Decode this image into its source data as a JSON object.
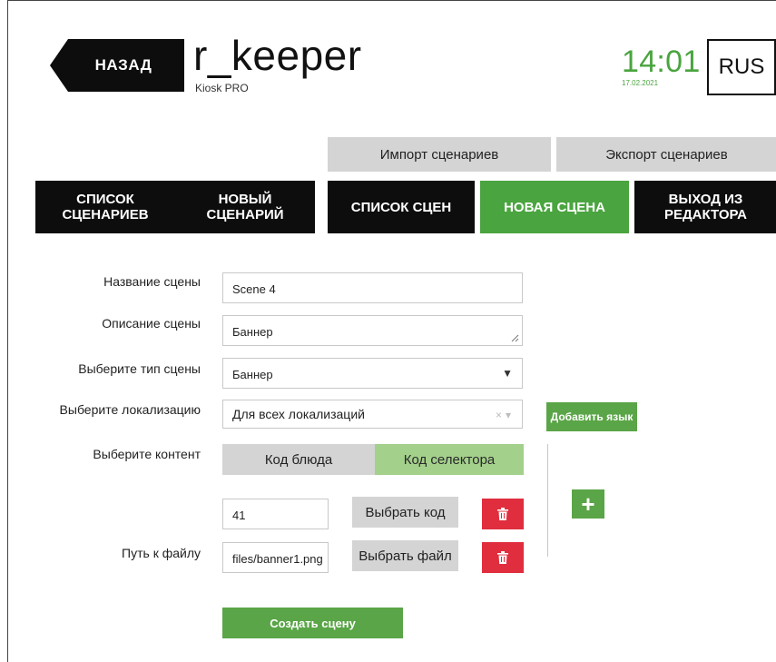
{
  "header": {
    "back_label": "НАЗАД",
    "app_title": "r_keeper",
    "app_subtitle": "Kiosk PRO",
    "time": "14:01",
    "date": "17.02.2021",
    "language": "RUS"
  },
  "actions": {
    "import_label": "Импорт сценариев",
    "export_label": "Экспорт сценариев"
  },
  "tabs": [
    {
      "label": "СПИСОК\nСЦЕНАРИЕВ",
      "active": false
    },
    {
      "label": "НОВЫЙ\nСЦЕНАРИЙ",
      "active": false
    },
    {
      "label": "СПИСОК СЦЕН",
      "active": false
    },
    {
      "label": "НОВАЯ СЦЕНА",
      "active": true
    },
    {
      "label": "ВЫХОД ИЗ\nРЕДАКТОРА",
      "active": false
    }
  ],
  "form": {
    "scene_name": {
      "label": "Название сцены",
      "value": "Scene 4"
    },
    "scene_description": {
      "label": "Описание сцены",
      "value": "Баннер"
    },
    "scene_type": {
      "label": "Выберите тип сцены",
      "value": "Баннер"
    },
    "localization": {
      "label": "Выберите локализацию",
      "value": "Для всех локализаций",
      "clear_glyph": "×",
      "dropdown_glyph": "▾"
    },
    "add_language_label": "Добавить язык",
    "content": {
      "label": "Выберите контент",
      "options": [
        "Код блюда",
        "Код селектора"
      ],
      "selected": "Код селектора"
    },
    "code_value": "41",
    "choose_code_label": "Выбрать код",
    "file_path": {
      "label": "Путь к файлу",
      "value": "files/banner1.png"
    },
    "choose_file_label": "Выбрать файл",
    "plus_label": "+",
    "create_label": "Создать сцену"
  },
  "colors": {
    "accent_green": "#4aa43f",
    "button_green": "#5aa547",
    "segment_selected": "#a3d08b",
    "delete_red": "#e02e3e",
    "neutral_gray": "#d4d4d4",
    "dark": "#0d0d0d"
  },
  "icons": {
    "back": "back-arrow-shape",
    "trash": "trash-icon",
    "plus": "plus-icon",
    "dropdown": "chevron-down-icon",
    "resize": "resize-handle-icon"
  }
}
